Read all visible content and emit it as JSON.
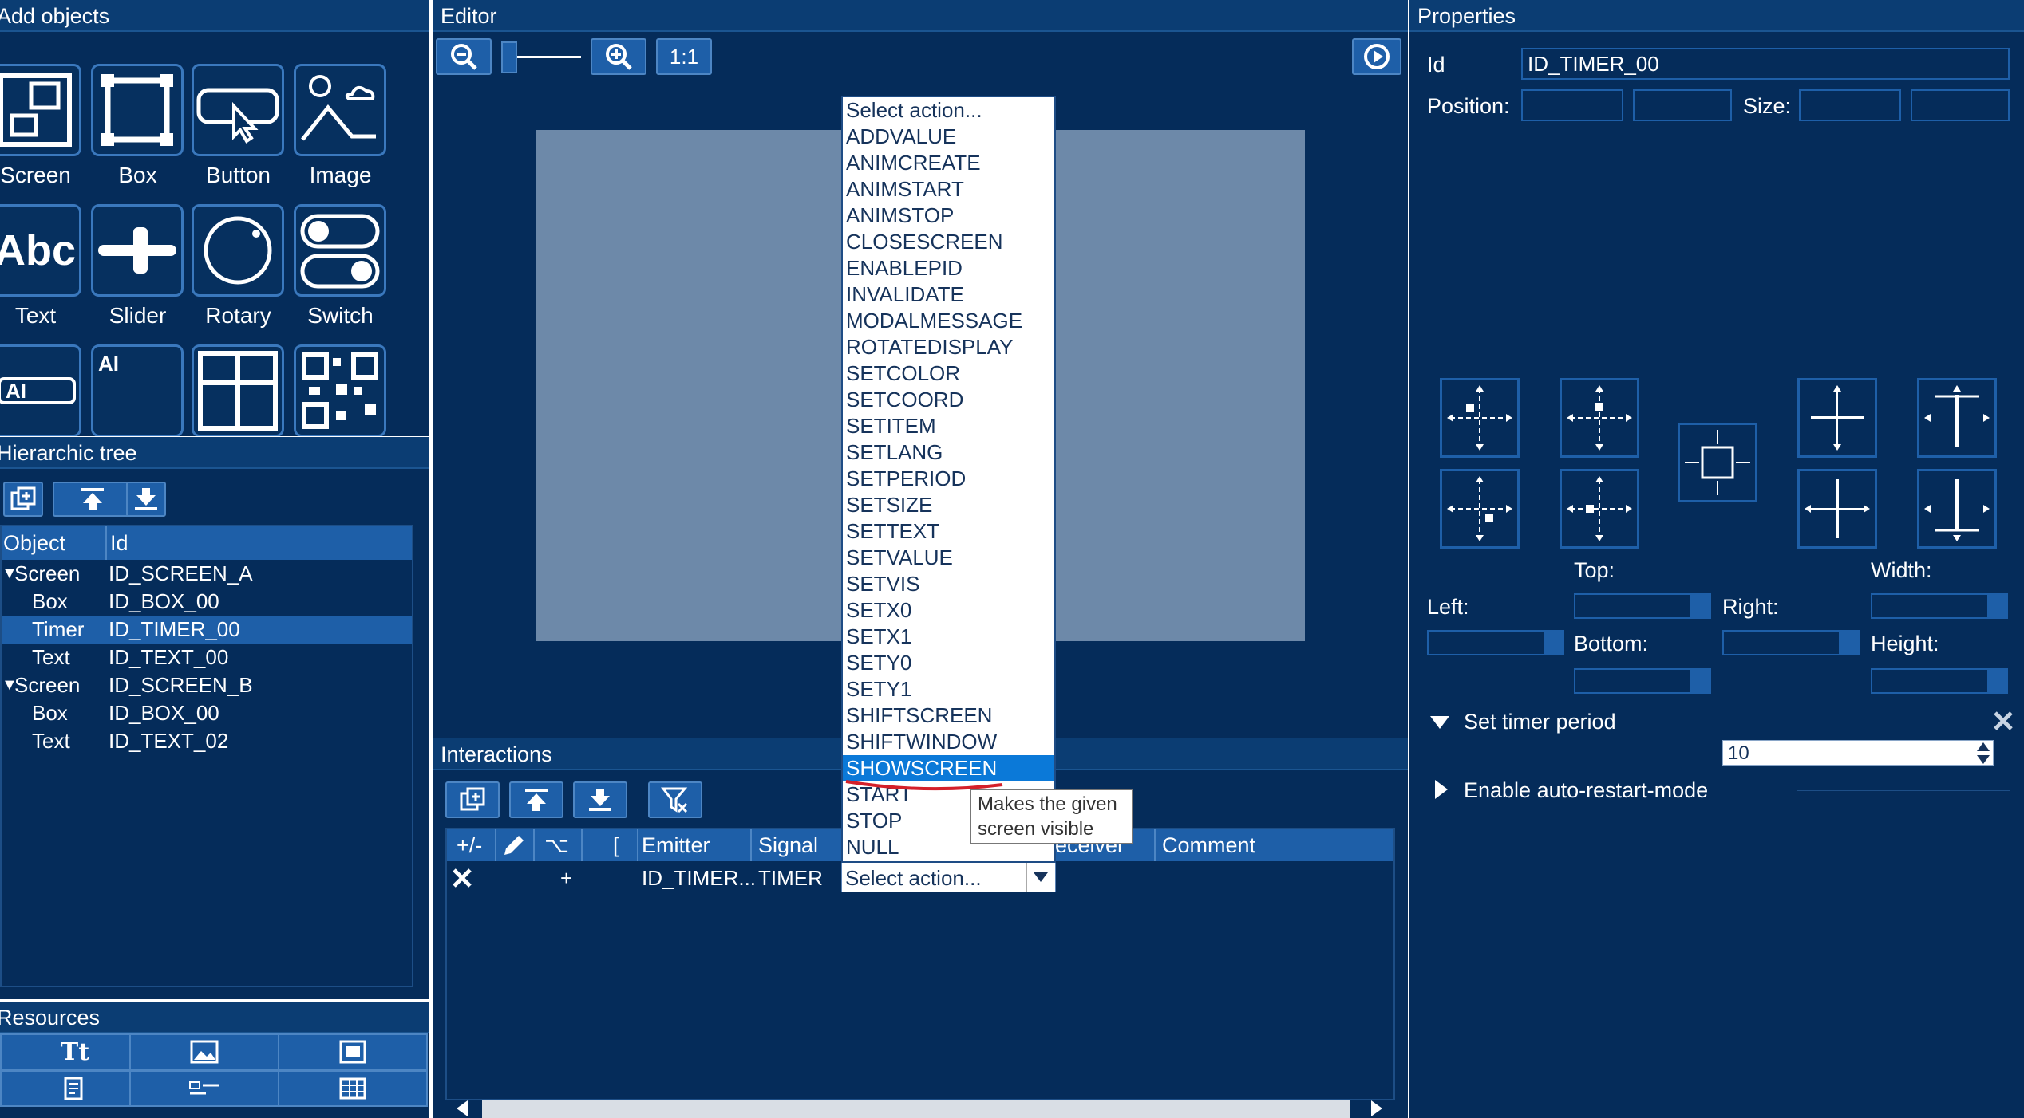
{
  "panels": {
    "add_objects": "Add objects",
    "hierarchic_tree": "Hierarchic tree",
    "resources": "Resources",
    "editor": "Editor",
    "interactions": "Interactions",
    "properties": "Properties"
  },
  "add_objects": {
    "items": [
      {
        "label": "Screen",
        "icon": "screen-icon"
      },
      {
        "label": "Box",
        "icon": "box-icon"
      },
      {
        "label": "Button",
        "icon": "button-icon"
      },
      {
        "label": "Image",
        "icon": "image-icon"
      },
      {
        "label": "Text",
        "icon": "text-icon",
        "glyph": "Abc"
      },
      {
        "label": "Slider",
        "icon": "slider-icon"
      },
      {
        "label": "Rotary",
        "icon": "rotary-icon"
      },
      {
        "label": "Switch",
        "icon": "switch-icon"
      },
      {
        "label": "",
        "icon": "edit-icon",
        "glyph": "AI"
      },
      {
        "label": "",
        "icon": "multiedit-icon",
        "glyph": "AI"
      },
      {
        "label": "",
        "icon": "listview-icon"
      },
      {
        "label": "",
        "icon": "qrcode-icon"
      }
    ]
  },
  "tree": {
    "col_object": "Object",
    "col_id": "Id",
    "rows": [
      {
        "object": "Screen",
        "id": "ID_SCREEN_A",
        "level": 0,
        "expanded": true
      },
      {
        "object": "Box",
        "id": "ID_BOX_00",
        "level": 1
      },
      {
        "object": "Timer",
        "id": "ID_TIMER_00",
        "level": 1,
        "selected": true
      },
      {
        "object": "Text",
        "id": "ID_TEXT_00",
        "level": 1
      },
      {
        "object": "Screen",
        "id": "ID_SCREEN_B",
        "level": 0,
        "expanded": true
      },
      {
        "object": "Box",
        "id": "ID_BOX_00",
        "level": 1
      },
      {
        "object": "Text",
        "id": "ID_TEXT_02",
        "level": 1
      }
    ]
  },
  "editor": {
    "zoom_reset_label": "1:1"
  },
  "dropdown": {
    "items": [
      "Select action...",
      "ADDVALUE",
      "ANIMCREATE",
      "ANIMSTART",
      "ANIMSTOP",
      "CLOSESCREEN",
      "ENABLEPID",
      "INVALIDATE",
      "MODALMESSAGE",
      "ROTATEDISPLAY",
      "SETCOLOR",
      "SETCOORD",
      "SETITEM",
      "SETLANG",
      "SETPERIOD",
      "SETSIZE",
      "SETTEXT",
      "SETVALUE",
      "SETVIS",
      "SETX0",
      "SETX1",
      "SETY0",
      "SETY1",
      "SHIFTSCREEN",
      "SHIFTWINDOW",
      "SHOWSCREEN",
      "START",
      "STOP",
      "NULL"
    ],
    "highlighted": "SHOWSCREEN",
    "tooltip_line1": "Makes the given",
    "tooltip_line2": "screen visible"
  },
  "interactions": {
    "headers": {
      "plusminus": "+/-",
      "bracket": "[",
      "emitter": "Emitter",
      "signal": "Signal",
      "receiver": "eceiver",
      "comment": "Comment"
    },
    "row": {
      "plus": "+",
      "emitter": "ID_TIMER...",
      "signal": "TIMER",
      "action": "Select action..."
    }
  },
  "properties": {
    "id_label": "Id",
    "id_value": "ID_TIMER_00",
    "position_label": "Position:",
    "size_label": "Size:",
    "top_label": "Top:",
    "width_label": "Width:",
    "left_label": "Left:",
    "right_label": "Right:",
    "bottom_label": "Bottom:",
    "height_label": "Height:",
    "timer_section": "Set timer period",
    "timer_value": "10",
    "autorestart_section": "Enable auto-restart-mode"
  },
  "colors": {
    "panel_bg": "#052c5a",
    "title_bg": "#0b3d73",
    "button_bg": "#1e5fa8",
    "highlight": "#0b79d8",
    "canvas": "#6d89a9"
  }
}
